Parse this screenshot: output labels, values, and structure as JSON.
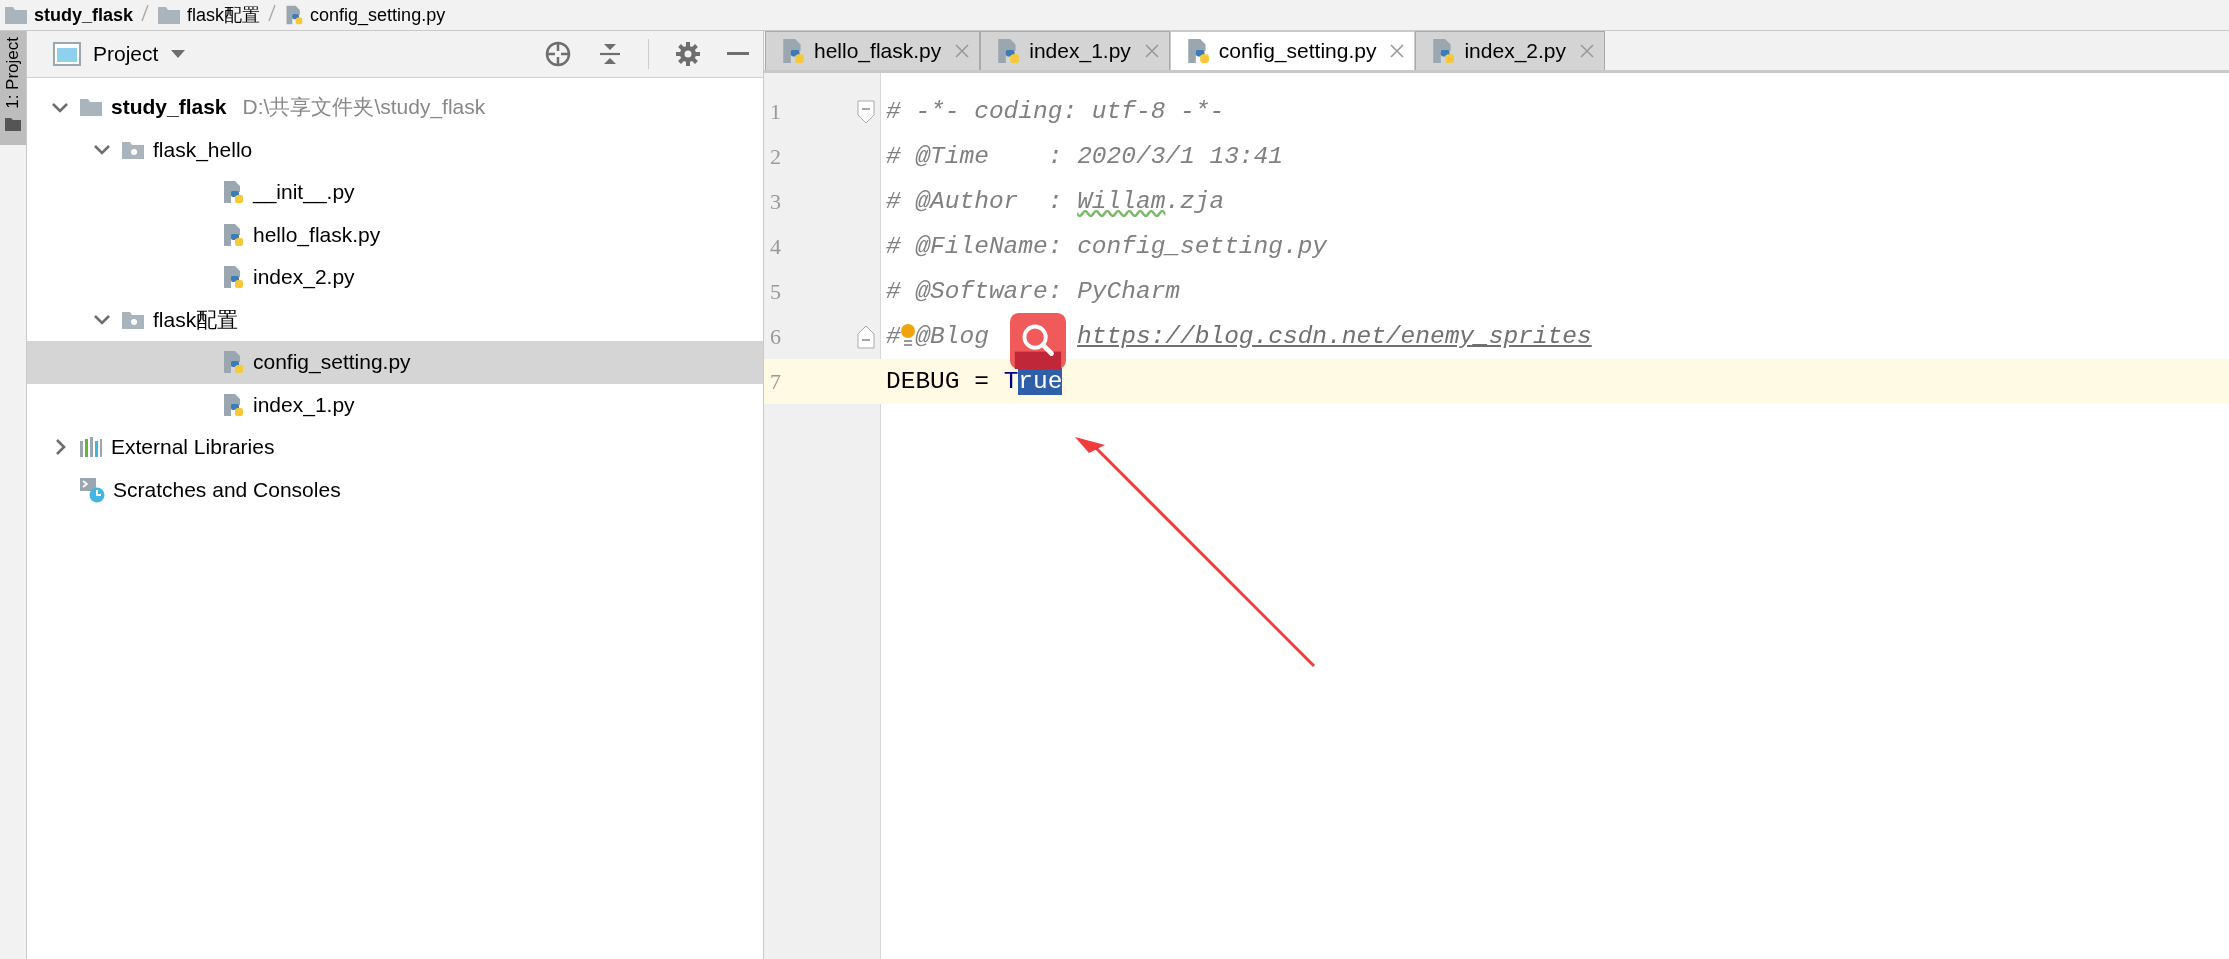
{
  "breadcrumb": [
    {
      "label": "study_flask",
      "kind": "project"
    },
    {
      "label": "flask配置",
      "kind": "folder"
    },
    {
      "label": "config_setting.py",
      "kind": "python"
    }
  ],
  "tool_strip": {
    "label": "1: Project",
    "selected": true
  },
  "project_panel": {
    "title": "Project"
  },
  "project_tree": [
    {
      "label": "study_flask",
      "kind": "project",
      "path": "D:\\共享文件夹\\study_flask",
      "expanded": true,
      "selected": false,
      "children": [
        {
          "label": "flask_hello",
          "kind": "folder",
          "expanded": true,
          "selected": false,
          "children": [
            {
              "label": "__init__.py",
              "kind": "python",
              "selected": false
            },
            {
              "label": "hello_flask.py",
              "kind": "python",
              "selected": false
            },
            {
              "label": "index_2.py",
              "kind": "python",
              "selected": false
            }
          ]
        },
        {
          "label": "flask配置",
          "kind": "folder",
          "expanded": true,
          "selected": false,
          "children": [
            {
              "label": "config_setting.py",
              "kind": "python",
              "selected": true
            },
            {
              "label": "index_1.py",
              "kind": "python",
              "selected": false
            }
          ]
        }
      ]
    },
    {
      "label": "External Libraries",
      "kind": "libraries",
      "expanded": false,
      "selected": false
    },
    {
      "label": "Scratches and Consoles",
      "kind": "scratches",
      "selected": false
    }
  ],
  "tabs": [
    {
      "label": "hello_flask.py",
      "selected": false
    },
    {
      "label": "index_1.py",
      "selected": false
    },
    {
      "label": "config_setting.py",
      "selected": true
    },
    {
      "label": "index_2.py",
      "selected": false
    }
  ],
  "code_lines": [
    {
      "number": "1",
      "kind": "fold-start",
      "current": false,
      "tokens": [
        {
          "text": "# -*- coding: utf-8 -*-",
          "kind": "comment"
        }
      ]
    },
    {
      "number": "2",
      "kind": "plain",
      "current": false,
      "tokens": [
        {
          "text": "# @Time    : 2020/3/1 13:41",
          "kind": "comment"
        }
      ]
    },
    {
      "number": "3",
      "kind": "plain",
      "current": false,
      "tokens": [
        {
          "text": "# @Author  : ",
          "kind": "comment"
        },
        {
          "text": "Willam",
          "kind": "typo"
        },
        {
          "text": ".zja",
          "kind": "comment"
        }
      ]
    },
    {
      "number": "4",
      "kind": "plain",
      "current": false,
      "tokens": [
        {
          "text": "# @FileName: config_setting.py",
          "kind": "comment"
        }
      ]
    },
    {
      "number": "5",
      "kind": "plain",
      "current": false,
      "tokens": [
        {
          "text": "# @Software: PyCharm",
          "kind": "comment"
        }
      ]
    },
    {
      "number": "6",
      "kind": "fold-end",
      "current": false,
      "tokens": [
        {
          "text": "#",
          "kind": "comment"
        },
        {
          "kind": "bulb"
        },
        {
          "text": "@Blog",
          "kind": "comment"
        },
        {
          "text": "https://blog.csdn.net/enemy_sprites",
          "kind": "link"
        }
      ]
    },
    {
      "number": "7",
      "kind": "plain",
      "current": true,
      "tokens": [
        {
          "text": "DEBUG = ",
          "kind": "code"
        },
        {
          "text": "T",
          "kind": "keyword"
        },
        {
          "text": "rue",
          "kind": "selection"
        }
      ]
    }
  ]
}
